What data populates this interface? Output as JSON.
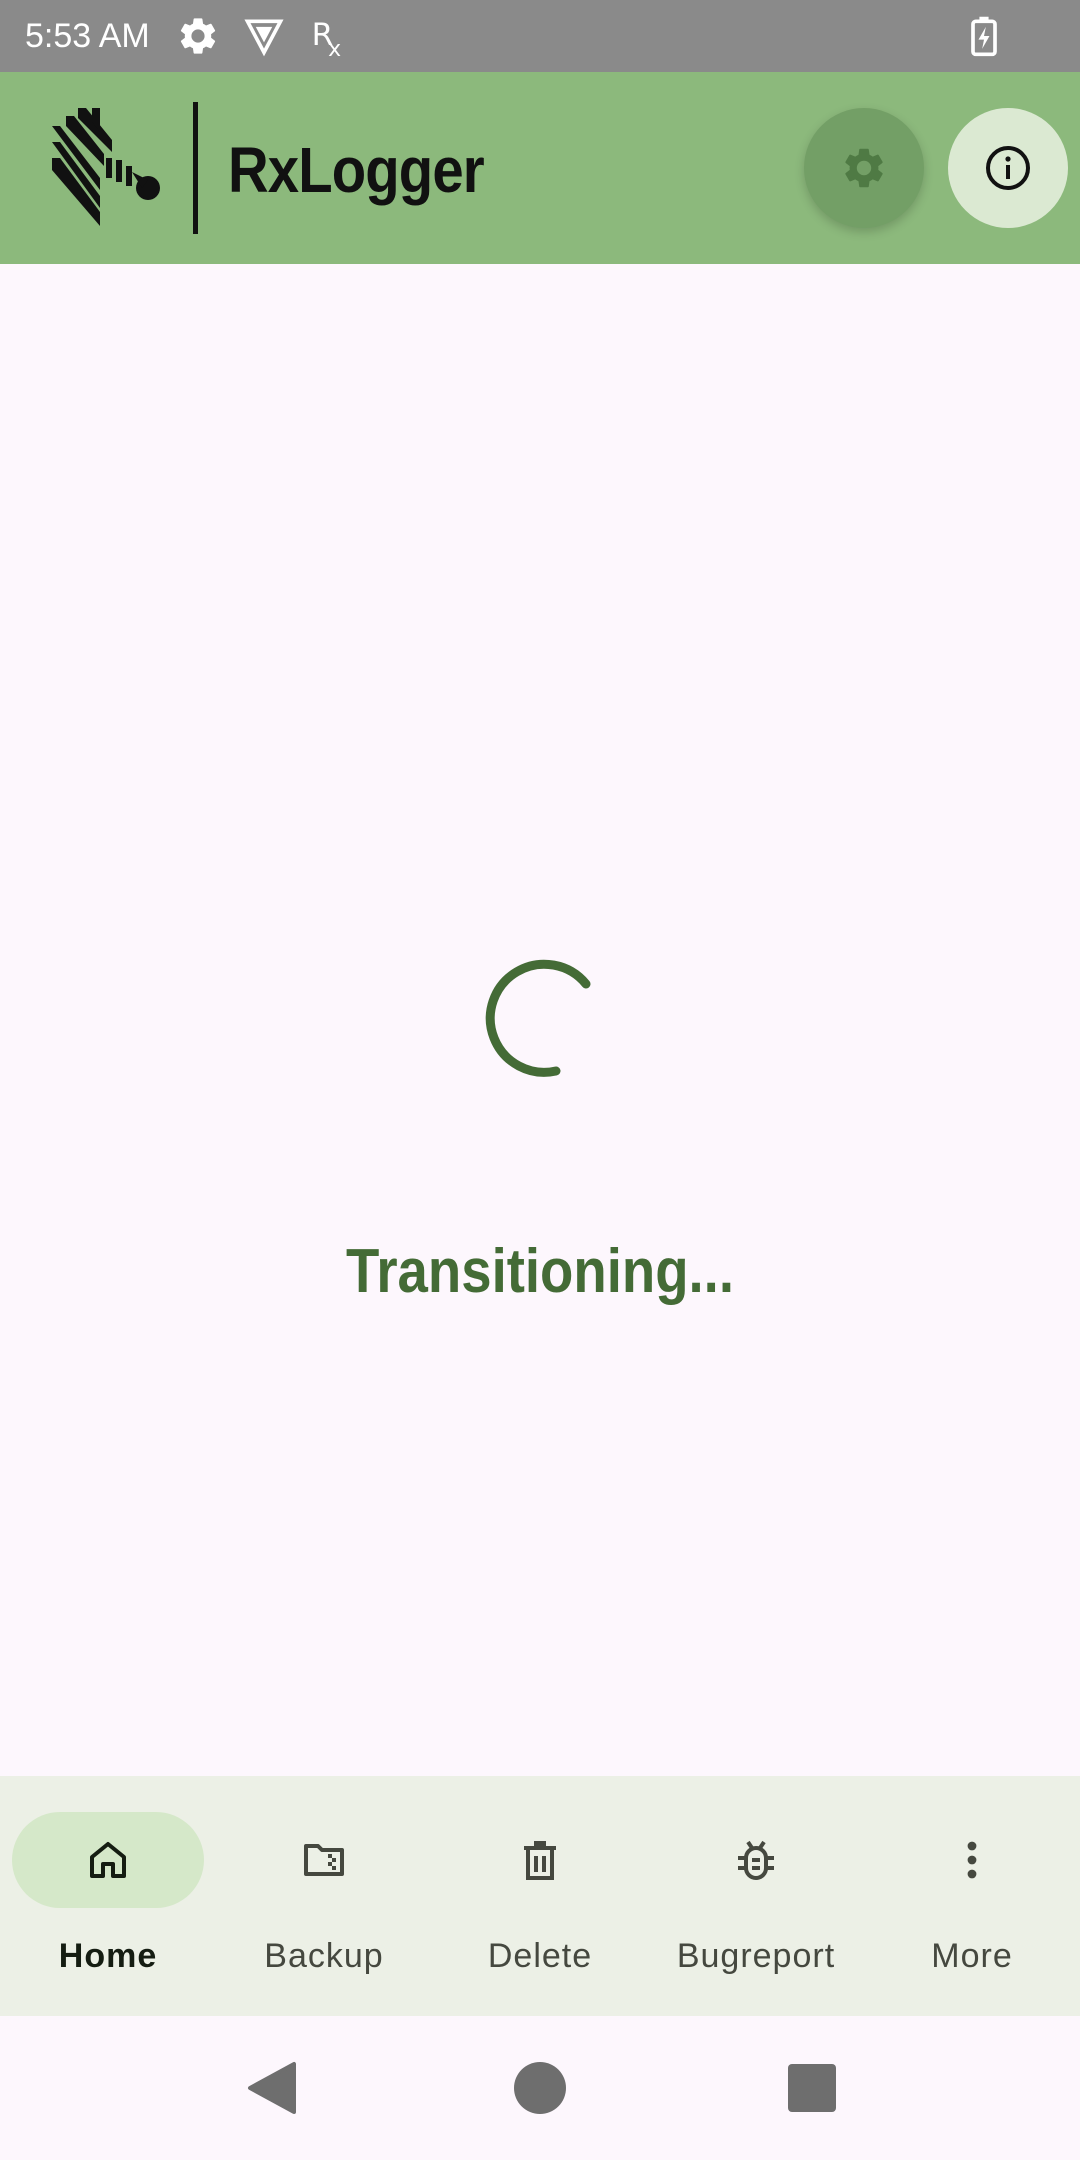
{
  "status_bar": {
    "time": "5:53 AM",
    "icons": [
      "settings-icon",
      "vpn-shield-icon",
      "rx-icon",
      "battery-charging-icon"
    ]
  },
  "app_bar": {
    "title": "RxLogger",
    "logo": "zebra-logo-icon",
    "actions": [
      "settings-icon",
      "info-icon"
    ]
  },
  "main": {
    "loading_text": "Transitioning...",
    "spinner": "progress-spinner"
  },
  "bottom_nav": {
    "items": [
      {
        "label": "Home",
        "icon": "home-icon",
        "active": true
      },
      {
        "label": "Backup",
        "icon": "folder-zip-icon",
        "active": false
      },
      {
        "label": "Delete",
        "icon": "trash-icon",
        "active": false
      },
      {
        "label": "Bugreport",
        "icon": "bug-icon",
        "active": false
      },
      {
        "label": "More",
        "icon": "more-vert-icon",
        "active": false
      }
    ]
  },
  "system_nav": {
    "buttons": [
      "back-icon",
      "home-circle-icon",
      "recents-icon"
    ]
  },
  "colors": {
    "status_bar": "#8a8a8a",
    "app_bar": "#8cb97c",
    "background": "#fdf7fd",
    "accent": "#446b36",
    "nav_background": "#ecf0e6",
    "active_pill": "#d5e8c9"
  }
}
